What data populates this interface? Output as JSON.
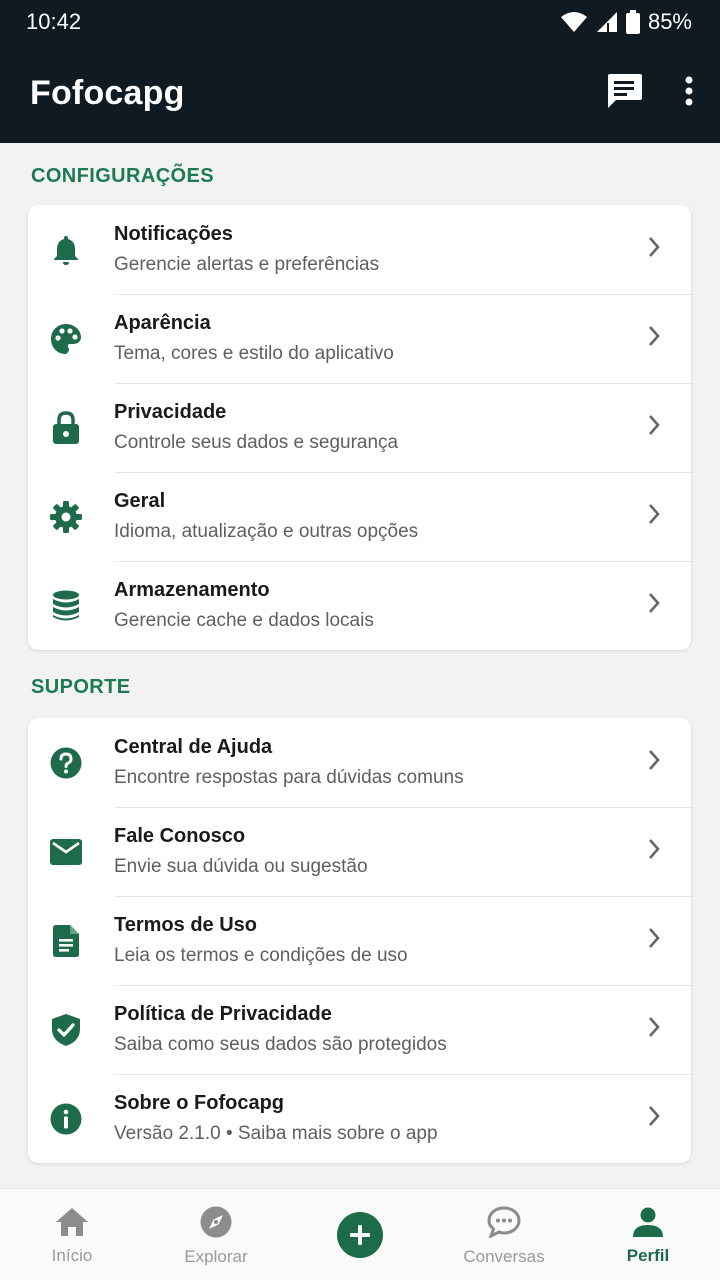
{
  "status": {
    "time": "10:42",
    "battery": "85%"
  },
  "app": {
    "title": "Fofocapg"
  },
  "colors": {
    "accent": "#1e6b4c",
    "section": "#1e7a55",
    "appbar": "#0f1a22"
  },
  "sections": [
    {
      "title": "CONFIGURAÇÕES",
      "items": [
        {
          "icon": "bell-icon",
          "title": "Notificações",
          "subtitle": "Gerencie alertas e preferências"
        },
        {
          "icon": "palette-icon",
          "title": "Aparência",
          "subtitle": "Tema, cores e estilo do aplicativo"
        },
        {
          "icon": "lock-icon",
          "title": "Privacidade",
          "subtitle": "Controle seus dados e segurança"
        },
        {
          "icon": "gear-icon",
          "title": "Geral",
          "subtitle": "Idioma, atualização e outras opções"
        },
        {
          "icon": "database-icon",
          "title": "Armazenamento",
          "subtitle": "Gerencie cache e dados locais"
        }
      ]
    },
    {
      "title": "SUPORTE",
      "items": [
        {
          "icon": "help-icon",
          "title": "Central de Ajuda",
          "subtitle": "Encontre respostas para dúvidas comuns"
        },
        {
          "icon": "mail-icon",
          "title": "Fale Conosco",
          "subtitle": "Envie sua dúvida ou sugestão"
        },
        {
          "icon": "document-icon",
          "title": "Termos de Uso",
          "subtitle": "Leia os termos e condições de uso"
        },
        {
          "icon": "shield-check-icon",
          "title": "Política de Privacidade",
          "subtitle": "Saiba como seus dados são protegidos"
        },
        {
          "icon": "info-icon",
          "title": "Sobre o Fofocapg",
          "subtitle": "Versão 2.1.0 • Saiba mais sobre o app"
        }
      ]
    }
  ],
  "bottom_nav": [
    {
      "label": "Início",
      "icon": "home-icon",
      "active": false
    },
    {
      "label": "Explorar",
      "icon": "compass-icon",
      "active": false
    },
    {
      "label": "",
      "icon": "add-icon",
      "active": false
    },
    {
      "label": "Conversas",
      "icon": "chat-icon",
      "active": false
    },
    {
      "label": "Perfil",
      "icon": "person-icon",
      "active": true
    }
  ]
}
